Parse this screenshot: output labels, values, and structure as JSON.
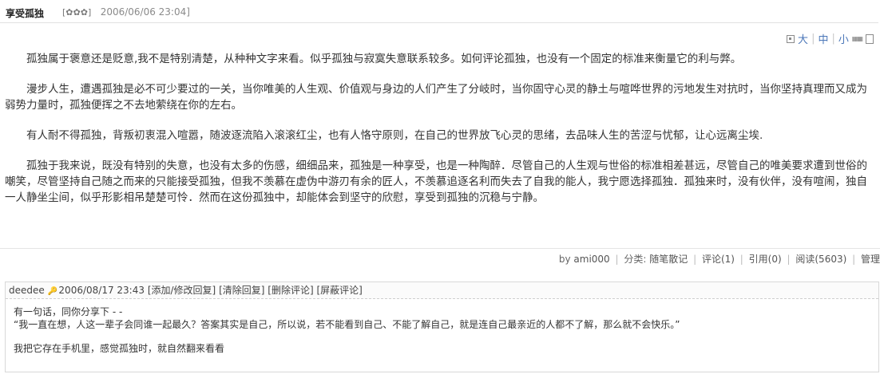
{
  "post": {
    "title": "享受孤独",
    "rating_stars": "[✿✿✿]",
    "date": "2006/06/06 23:04]"
  },
  "font_size": {
    "large": "大",
    "medium": "中",
    "small": "小",
    "separator": "|"
  },
  "article": {
    "paragraphs": [
      "孤独属于褒意还是贬意,我不是特别清楚，从种种文字来看。似乎孤独与寂寞失意联系较多。如何评论孤独，也没有一个固定的标准来衡量它的利与弊。",
      "漫步人生，遭遇孤独是必不可少要过的一关，当你唯美的人生观、价值观与身边的人们产生了分岐时，当你固守心灵的静土与喧哗世界的污地发生对抗时，当你坚持真理而又成为弱势力量时，孤独便挥之不去地萦绕在你的左右。",
      "有人耐不得孤独，背叛初衷混入喧嚣，随波逐流陷入滚滚红尘，也有人恪守原则，在自己的世界放飞心灵的思绪，去品味人生的苦涩与忧郁，让心远离尘埃.",
      "孤独于我来说，既没有特别的失意，也没有太多的伤感，细细品来，孤独是一种享受，也是一种陶醉．尽管自己的人生观与世俗的标准相差甚远，尽管自己的唯美要求遭到世俗的嘲笑，尽管坚持自己随之而来的只能接受孤独，但我不羡慕在虚伪中游刃有余的匠人，不羡慕追逐名利而失去了自我的能人，我宁愿选择孤独．孤独来时，没有伙伴，没有喧闹，独自一人静坐尘间，似乎形影相吊楚楚可怜．然而在这份孤独中，却能体会到坚守的欣慰，享受到孤独的沉稳与宁静。"
    ]
  },
  "footer": {
    "author_prefix": "by ",
    "author": "ami000",
    "category_label": "分类: ",
    "category": "随笔散记",
    "comments": "评论(1)",
    "references": "引用(0)",
    "reads": "阅读(5603)",
    "manage": "管理",
    "separator": "|"
  },
  "comment": {
    "author": "deedee",
    "date": "2006/08/17 23:43",
    "actions": [
      "[添加/修改回复]",
      "[清除回复]",
      "[删除评论]",
      "[屏蔽评论]"
    ],
    "lines": [
      "有一句话，同你分享下 -  -",
      "“我一直在想，人这一辈子会同谁一起最久？答案其实是自己，所以说，若不能看到自己、不能了解自己，就是连自己最亲近的人都不了解，那么就不会快乐。”",
      "我把它存在手机里，感觉孤独时，就自然翻来看看"
    ]
  }
}
